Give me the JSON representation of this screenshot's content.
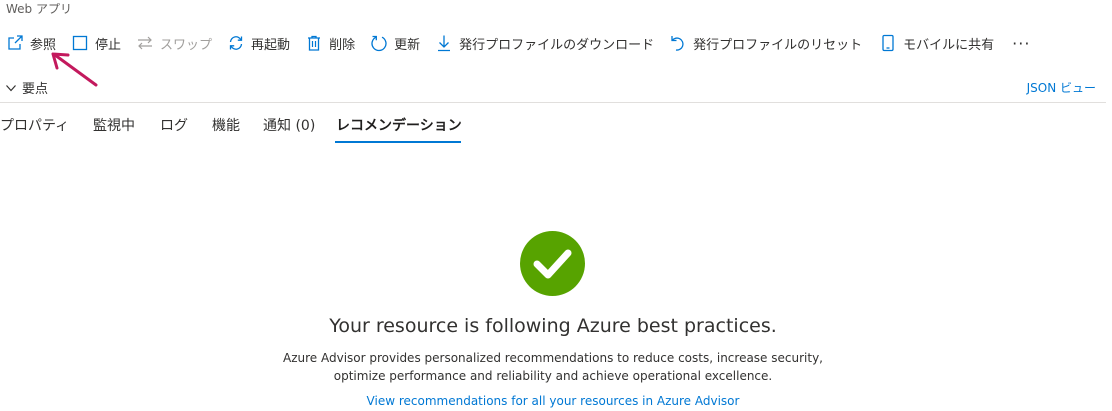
{
  "header": {
    "subtitle": "Web アプリ"
  },
  "toolbar": {
    "browse": "参照",
    "stop": "停止",
    "swap": "スワップ",
    "restart": "再起動",
    "delete": "削除",
    "refresh": "更新",
    "download_profile": "発行プロファイルのダウンロード",
    "reset_profile": "発行プロファイルのリセット",
    "share_mobile": "モバイルに共有",
    "more": "···"
  },
  "essentials": {
    "label": "要点",
    "json_view": "JSON ビュー"
  },
  "tabs": [
    {
      "label": "プロパティ"
    },
    {
      "label": "監視中"
    },
    {
      "label": "ログ"
    },
    {
      "label": "機能"
    },
    {
      "label": "通知 (0)"
    },
    {
      "label": "レコメンデーション",
      "active": true
    }
  ],
  "recommendations": {
    "title": "Your resource is following Azure best practices.",
    "description_line1": "Azure Advisor provides personalized recommendations to reduce costs, increase security,",
    "description_line2": "optimize performance and reliability and achieve operational excellence.",
    "link": "View recommendations for all your resources in Azure Advisor"
  },
  "colors": {
    "accent": "#0078d4",
    "success": "#57a300",
    "annotation_arrow": "#c3195d"
  }
}
